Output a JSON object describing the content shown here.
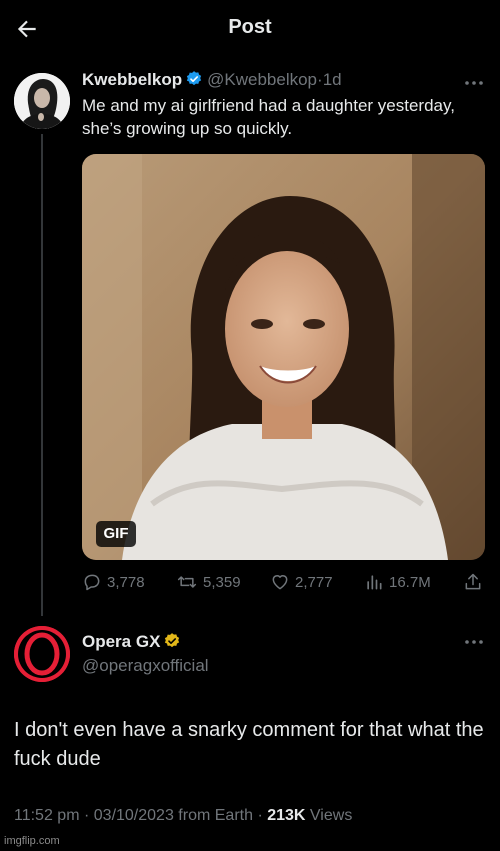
{
  "header": {
    "title": "Post"
  },
  "tweet1": {
    "name": "Kwebbelkop",
    "handle": "@Kwebbelkop",
    "dot": "·",
    "time": "1d",
    "text": "Me and my ai girlfriend had a daughter yesterday, she’s growing up so quickly.",
    "media_badge": "GIF",
    "stats": {
      "replies": "3,778",
      "reposts": "5,359",
      "likes": "2,777",
      "views": "16.7M"
    },
    "verified_color": "#1d9bf0"
  },
  "tweet2": {
    "name": "Opera GX",
    "handle": "@operagxofficial",
    "text": "I don't even have a snarky comment for that what the fuck dude",
    "time": "11:52 pm",
    "date": "03/10/2023",
    "source": "from Earth",
    "views_count": "213K",
    "views_label": "Views",
    "sep": "·",
    "verified_color": "#e2b719",
    "brand_color": "#e51f36"
  },
  "watermark": "imgflip.com"
}
